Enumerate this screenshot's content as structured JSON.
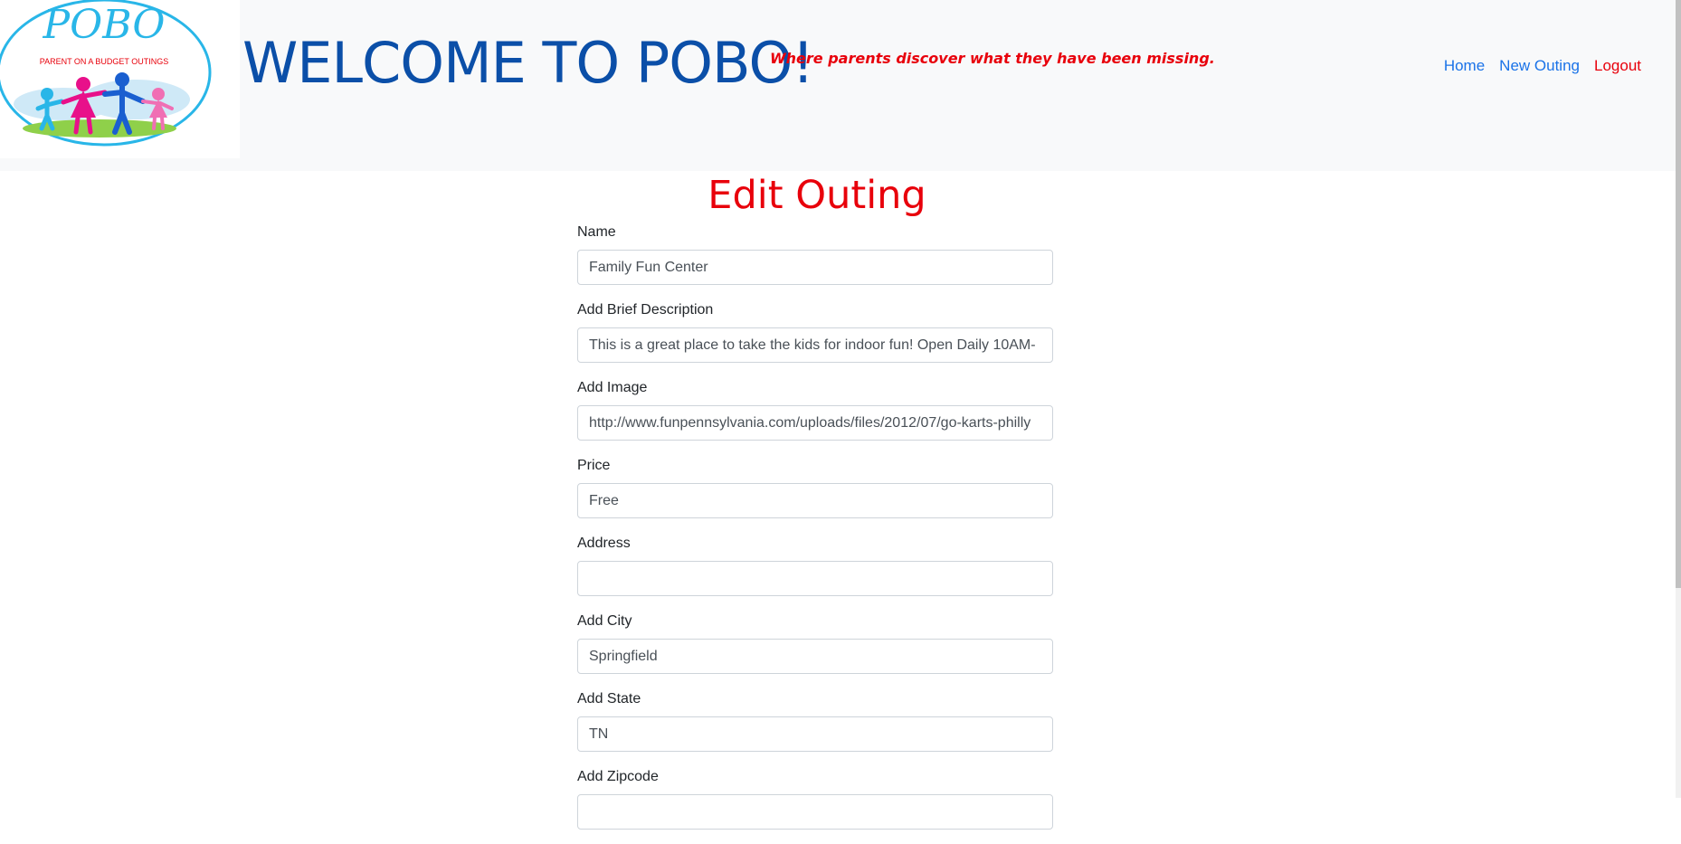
{
  "header": {
    "logo": {
      "brand": "POBO",
      "caption": "PARENT ON A BUDGET OUTINGS"
    },
    "title": "WELCOME TO POBO!",
    "tagline": "Where parents discover what they have been missing.",
    "nav": {
      "home": "Home",
      "new_outing": "New Outing",
      "logout": "Logout"
    }
  },
  "page": {
    "heading": "Edit Outing"
  },
  "form": {
    "fields": [
      {
        "label": "Name",
        "value": "Family Fun Center"
      },
      {
        "label": "Add Brief Description",
        "value": "This is a great place to take the kids for indoor fun! Open Daily 10AM-"
      },
      {
        "label": "Add Image",
        "value": "http://www.funpennsylvania.com/uploads/files/2012/07/go-karts-philly"
      },
      {
        "label": "Price",
        "value": "Free"
      },
      {
        "label": "Address",
        "value": ""
      },
      {
        "label": "Add City",
        "value": "Springfield"
      },
      {
        "label": "Add State",
        "value": "TN"
      },
      {
        "label": "Add Zipcode",
        "value": ""
      }
    ]
  },
  "colors": {
    "title_blue": "#0b4fa8",
    "accent_red": "#e8000b",
    "link_blue": "#1a73e8",
    "navbar_bg": "#f8f9fa"
  }
}
